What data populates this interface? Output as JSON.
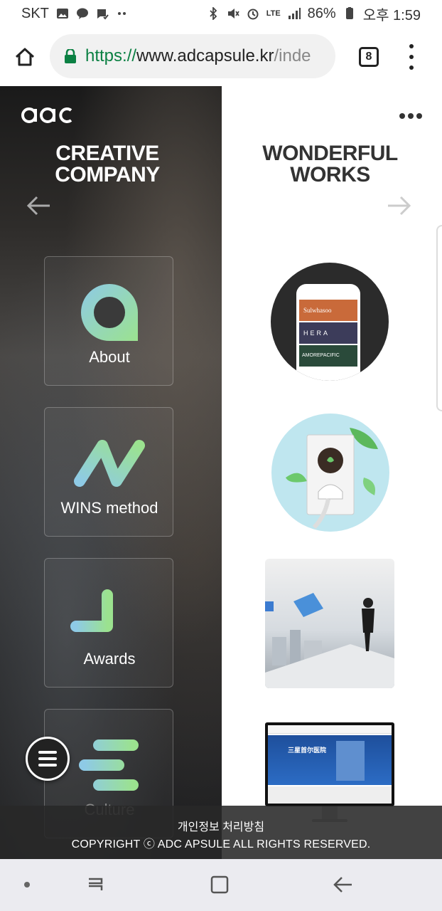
{
  "status_bar": {
    "carrier": "SKT",
    "network": "LTE",
    "battery": "86%",
    "time": "오후 1:59",
    "left_icons": [
      "image-icon",
      "kakao-talk-icon",
      "message-check-icon",
      "alarm-icon",
      "more-dots-icon"
    ],
    "right_icons": [
      "bluetooth-icon",
      "mute-icon",
      "alarm-icon",
      "signal-icon",
      "battery-icon"
    ]
  },
  "browser": {
    "url_scheme": "https://",
    "url_host": "www.adcapsule.kr",
    "url_path": "/inde",
    "tab_count": "8"
  },
  "site": {
    "logo_text": "adc",
    "left_heading": [
      "CREATIVE",
      "COMPANY"
    ],
    "right_heading": [
      "WONDERFUL",
      "WORKS"
    ],
    "menu_cards": [
      {
        "label": "About",
        "icon": "about-icon"
      },
      {
        "label": "WINS method",
        "icon": "wins-method-icon"
      },
      {
        "label": "Awards",
        "icon": "awards-icon"
      },
      {
        "label": "Culture",
        "icon": "culture-icon"
      }
    ],
    "works": [
      {
        "name": "amore-app-work",
        "texts": [
          "Sulwhasoo",
          "HERA",
          "AMOREPACIFIC"
        ]
      },
      {
        "name": "smart-plug-work"
      },
      {
        "name": "business-man-work"
      },
      {
        "name": "samsung-hospital-work",
        "texts": [
          "三星首尔医院"
        ]
      }
    ],
    "footer": {
      "privacy": "개인정보 처리방침",
      "copyright": "COPYRIGHT ⓒ ADC APSULE ALL RIGHTS RESERVED."
    }
  },
  "colors": {
    "url_green": "#0b8043",
    "card_gradient_start": "#8ecae6",
    "card_gradient_end": "#9be28f"
  }
}
